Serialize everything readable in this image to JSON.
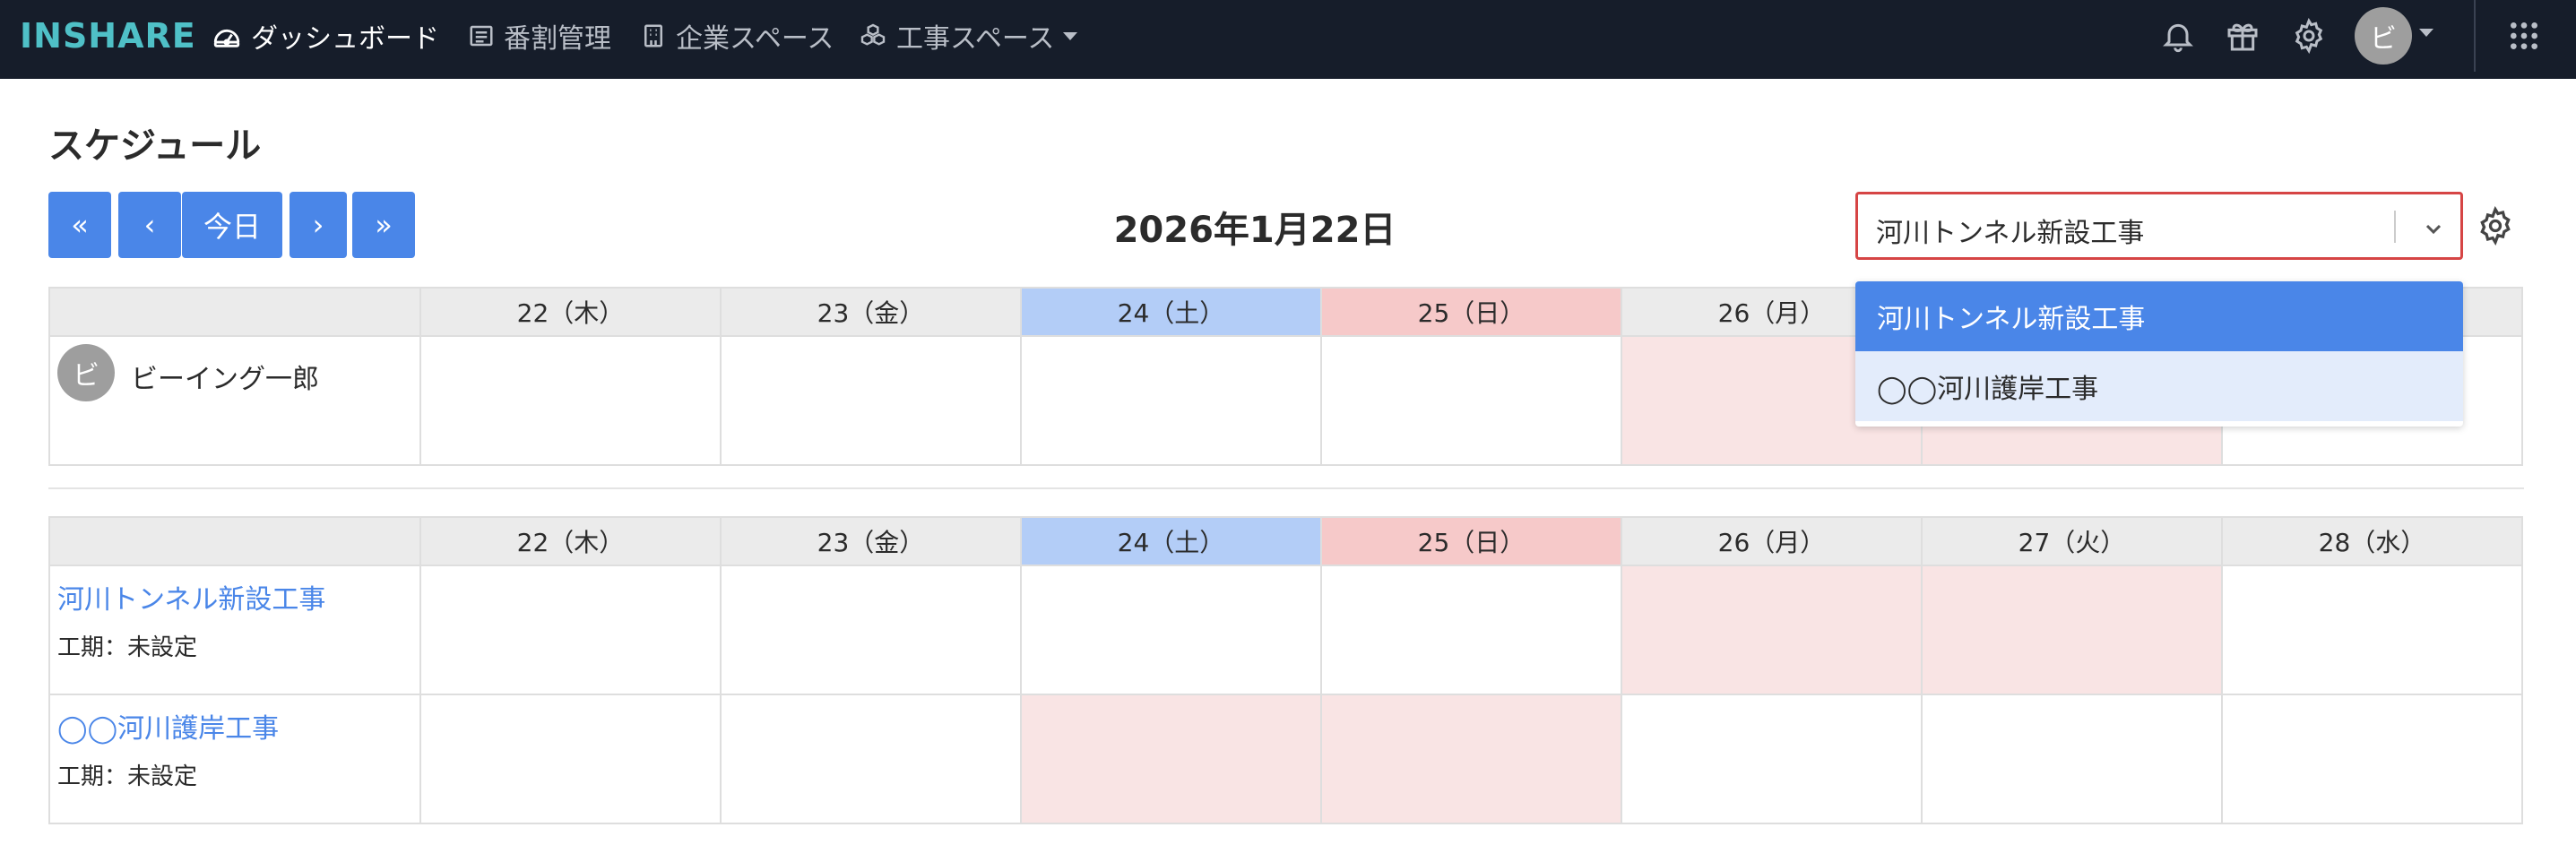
{
  "nav": {
    "logo": "INSHARE",
    "items": [
      {
        "label": "ダッシュボード"
      },
      {
        "label": "番割管理"
      },
      {
        "label": "企業スペース"
      },
      {
        "label": "工事スペース"
      }
    ],
    "avatar_initial": "ビ"
  },
  "page": {
    "title": "スケジュール",
    "current_date": "2026年1月22日"
  },
  "toolbar": {
    "first_label": "«",
    "prev_label": "‹",
    "today_label": "今日",
    "next_label": "›",
    "last_label": "»"
  },
  "project_select": {
    "value": "河川トンネル新設工事",
    "options": [
      "河川トンネル新設工事",
      "◯◯河川護岸工事"
    ]
  },
  "calendar_days": [
    "22（木）",
    "23（金）",
    "24（土）",
    "25（日）",
    "26（月）",
    "27（火）",
    "28（水）"
  ],
  "user_table": {
    "users": [
      {
        "initial": "ビ",
        "name": "ビーイング一郎"
      }
    ]
  },
  "project_table": {
    "projects": [
      {
        "name": "河川トンネル新設工事",
        "period": "工期：未設定"
      },
      {
        "name": "◯◯河川護岸工事",
        "period": "工期：未設定"
      }
    ]
  },
  "colors": {
    "nav_bg": "#161d2a",
    "logo": "#4fc0c7",
    "accent": "#4a86e8",
    "saturday_header": "#b3cdf7",
    "sunday_header": "#f6c9c9",
    "holiday_cell": "#f9e4e4",
    "select_border": "#d64545"
  },
  "icons": [
    "dashboard-icon",
    "list-icon",
    "building-icon",
    "cubes-icon",
    "bell-icon",
    "gift-icon",
    "gear-icon",
    "chevron-down-icon",
    "apps-grid-icon"
  ]
}
